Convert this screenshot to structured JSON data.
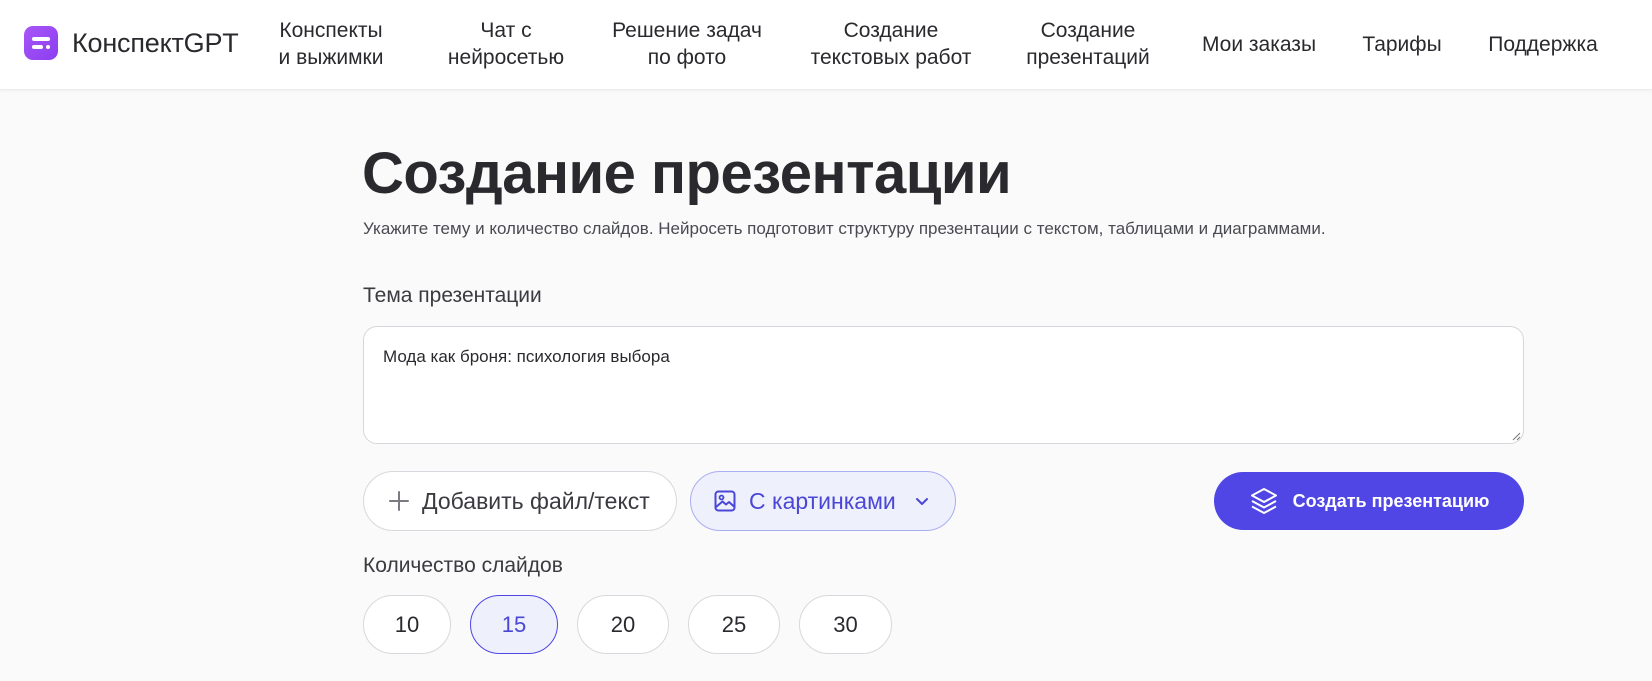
{
  "header": {
    "logo_text": "КонспектGPT",
    "logo_icon": "document-lines-icon",
    "nav": [
      {
        "label": "Конспекты\nи выжимки"
      },
      {
        "label": "Чат с\nнейросетью"
      },
      {
        "label": "Решение задач\nпо фото"
      },
      {
        "label": "Создание\nтекстовых работ"
      },
      {
        "label": "Создание\nпрезентаций"
      },
      {
        "label": "Мои заказы"
      },
      {
        "label": "Тарифы"
      },
      {
        "label": "Поддержка"
      }
    ]
  },
  "main": {
    "title": "Создание презентации",
    "subtitle": "Укажите тему и количество слайдов. Нейросеть подготовит структуру презентации с текстом, таблицами и диаграммами.",
    "topic_label": "Тема презентации",
    "topic_value": "Мода как броня: психология выбора",
    "add_file_label": "Добавить файл/текст",
    "images_label": "С картинками",
    "create_label": "Создать презентацию",
    "slides_label": "Количество слайдов",
    "slide_counts": [
      "10",
      "15",
      "20",
      "25",
      "30"
    ],
    "selected_slide_count": "15"
  },
  "colors": {
    "accent": "#4f46e5",
    "logo": "#a855f7",
    "selected_bg": "#eef0fc"
  }
}
